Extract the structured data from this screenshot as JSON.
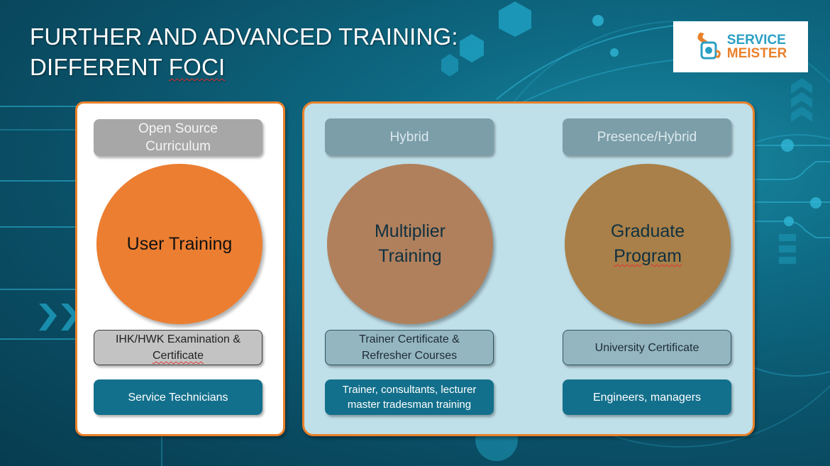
{
  "slide": {
    "title_line1": "FURTHER AND ADVANCED TRAINING:",
    "title_line2_a": "DIFFERENT ",
    "title_line2_b": "FOCI"
  },
  "logo": {
    "icon": "wrench-mug-icon",
    "word1": "SERVICE",
    "word2": "MEISTER",
    "colors": {
      "word1": "#2a9fc4",
      "word2": "#e9812b"
    }
  },
  "columns": [
    {
      "delivery": "Open Source Curriculum",
      "delivery_lines": [
        "Open Source",
        "Curriculum"
      ],
      "program": "User Training",
      "certificate_lines": [
        "IHK/HWK Examination &",
        "Certificate"
      ],
      "audience_lines": [
        "Service Technicians"
      ],
      "circle_color": "#ec7e31"
    },
    {
      "delivery": "Hybrid",
      "program_lines": [
        "Multiplier",
        "Training"
      ],
      "certificate_lines": [
        "Trainer Certificate &",
        "Refresher Courses"
      ],
      "audience_lines": [
        "Trainer, consultants, lecturer",
        "master tradesman training"
      ],
      "circle_color": "#b0805c"
    },
    {
      "delivery": "Presence/Hybrid",
      "program_lines": [
        "Graduate",
        "Program"
      ],
      "certificate_lines": [
        "University Certificate"
      ],
      "audience_lines": [
        "Engineers, managers"
      ],
      "circle_color": "#a98049"
    }
  ],
  "theme": {
    "accent_orange": "#e9812b",
    "teal_button": "#13708c",
    "panel_light_blue": "#bfdfe9"
  }
}
